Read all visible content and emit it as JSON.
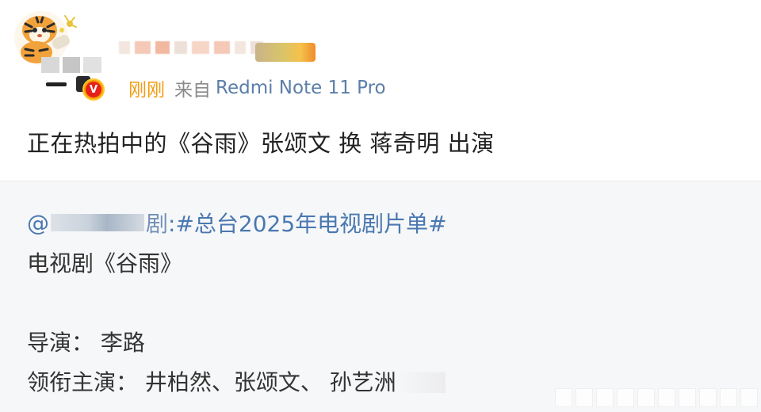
{
  "post": {
    "time": "刚刚",
    "source_prefix": "来自",
    "device": "Redmi Note 11 Pro",
    "verified_mark": "V",
    "text": "正在热拍中的《谷雨》张颂文 换 蒋奇明 出演"
  },
  "repost": {
    "author_prefix": "@",
    "author_suffix": "剧",
    "hashtag": ":#总台2025年电视剧片单#",
    "title": "电视剧《谷雨》",
    "director": "导演：  李路",
    "cast": "领衔主演：  井柏然、张颂文、 孙艺洲"
  },
  "colors": {
    "time": "#f39c12",
    "device": "#5b7ea8",
    "link": "#4a78b0",
    "repost_bg": "#f6f7f9"
  },
  "icons": {
    "avatar": "tiger-avatar-icon",
    "verified": "verified-badge-icon",
    "level": "level-badge-icon"
  }
}
